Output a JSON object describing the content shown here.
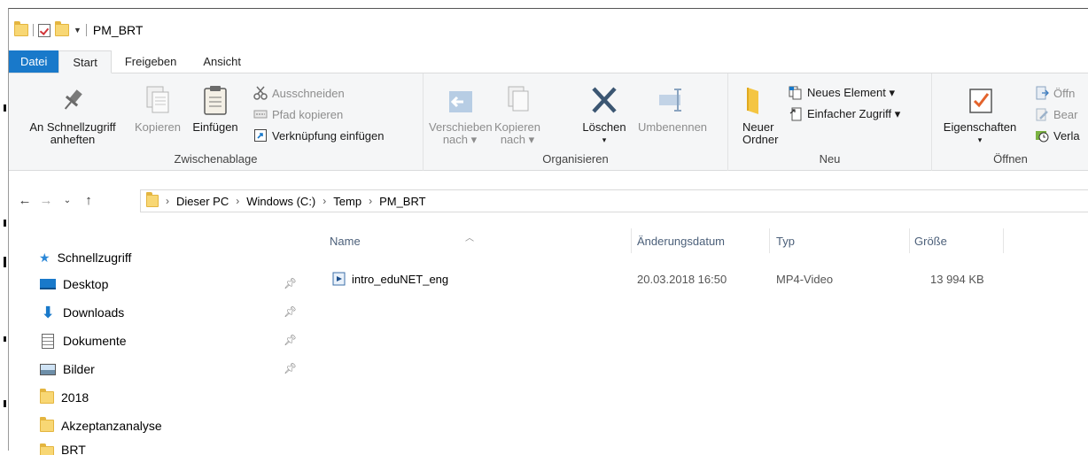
{
  "window": {
    "title": "PM_BRT"
  },
  "tabs": [
    "Datei",
    "Start",
    "Freigeben",
    "Ansicht"
  ],
  "ribbon": {
    "zwischenablage": {
      "label": "Zwischenablage",
      "pin_line1": "An Schnellzugriff",
      "pin_line2": "anheften",
      "copy": "Kopieren",
      "paste": "Einfügen",
      "cut": "Ausschneiden",
      "copy_path": "Pfad kopieren",
      "paste_shortcut": "Verknüpfung einfügen"
    },
    "organisieren": {
      "label": "Organisieren",
      "move_line1": "Verschieben",
      "move_line2": "nach ▾",
      "copyto_line1": "Kopieren",
      "copyto_line2": "nach ▾",
      "delete": "Löschen",
      "delete_arrow": "▾",
      "rename": "Umbenennen"
    },
    "neu": {
      "label": "Neu",
      "new_folder_line1": "Neuer",
      "new_folder_line2": "Ordner",
      "new_item": "Neues Element ▾",
      "easy_access": "Einfacher Zugriff ▾"
    },
    "oeffnen": {
      "label": "Öffnen",
      "properties": "Eigenschaften",
      "properties_arrow": "▾",
      "open": "Öffn",
      "edit": "Bear",
      "history": "Verla"
    }
  },
  "address": {
    "crumbs": [
      "Dieser PC",
      "Windows (C:)",
      "Temp",
      "PM_BRT"
    ]
  },
  "nav": {
    "quick_access": "Schnellzugriff",
    "items": [
      "Desktop",
      "Downloads",
      "Dokumente",
      "Bilder",
      "2018",
      "Akzeptanzanalyse",
      "BRT"
    ]
  },
  "columns": {
    "name": "Name",
    "date": "Änderungsdatum",
    "type": "Typ",
    "size": "Größe"
  },
  "files": [
    {
      "name": "intro_eduNET_eng",
      "date": "20.03.2018 16:50",
      "type": "MP4-Video",
      "size": "13 994 KB"
    }
  ],
  "colors": {
    "accent": "#1979ca",
    "folder": "#f8d774",
    "header_text": "#4c607a"
  }
}
